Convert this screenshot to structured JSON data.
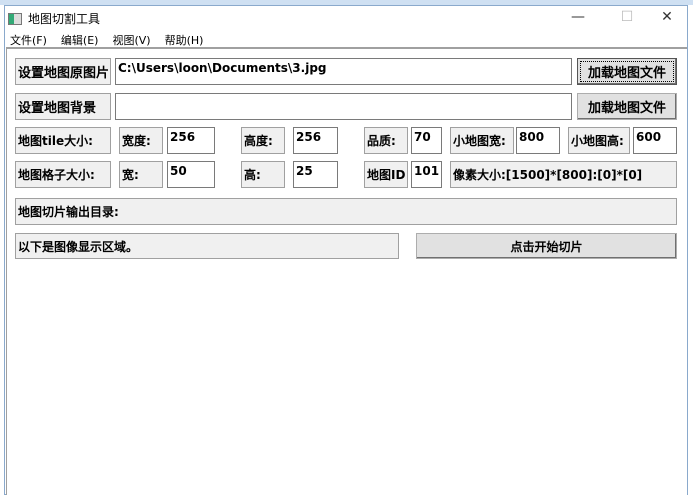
{
  "window": {
    "title": "地图切割工具",
    "minimize": "—",
    "maximize": "☐",
    "close": "✕"
  },
  "menu": [
    "文件(F)",
    "编辑(E)",
    "视图(V)",
    "帮助(H)"
  ],
  "row1": {
    "label": "设置地图原图片",
    "value": "C:\\Users\\loon\\Documents\\3.jpg",
    "button": "加载地图文件"
  },
  "row2": {
    "label": "设置地图背景",
    "value": "",
    "button": "加载地图文件"
  },
  "row3": {
    "label": "地图tile大小:",
    "width_label": "宽度:",
    "width": "256",
    "height_label": "高度:",
    "height": "256",
    "quality_label": "品质:",
    "quality": "70",
    "mini_w_label": "小地图宽:",
    "mini_w": "800",
    "mini_h_label": "小地图高:",
    "mini_h": "600"
  },
  "row4": {
    "label": "地图格子大小:",
    "w_label": "宽:",
    "w": "50",
    "h_label": "高:",
    "h": "25",
    "id_label": "地图ID",
    "id": "101",
    "pixel_size": "像素大小:[1500]*[800]:[0]*[0]"
  },
  "output_dir": "地图切片输出目录:",
  "display_hint": "以下是图像显示区域。",
  "start_button": "点击开始切片"
}
